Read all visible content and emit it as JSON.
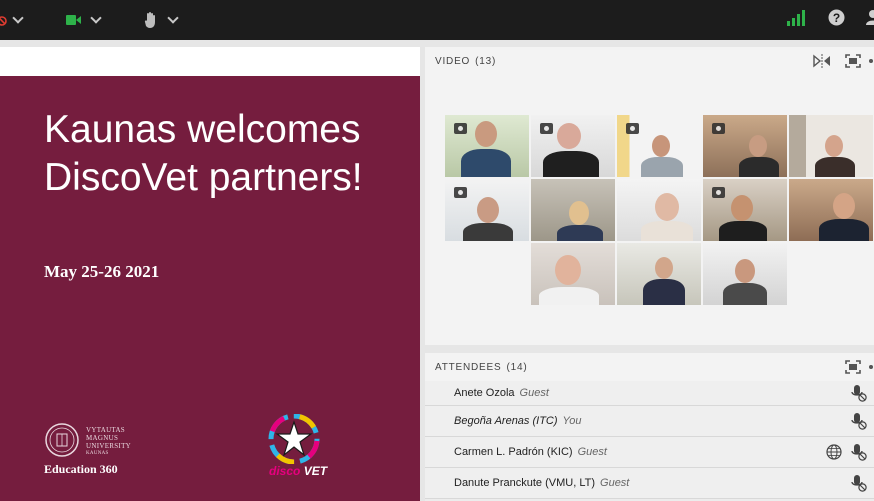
{
  "toolbar": {
    "mic_icon": "mic-muted-icon",
    "camera_icon": "camera-icon",
    "hand_icon": "raise-hand-icon",
    "signal_icon": "signal-icon",
    "help_icon": "help-icon",
    "colors": {
      "camera": "#2eb24a",
      "signal": "#2eb24a",
      "muted": "#e03c31"
    }
  },
  "slide": {
    "title": "Kaunas welcomes DiscoVet partners!",
    "date": "May 25-26 2021",
    "vmu_lines": [
      "VYTAUTAS",
      "MAGNUS",
      "UNIVERSITY",
      "KAUNAS"
    ],
    "education_label": "Education 360",
    "disco_label_1": "disco",
    "disco_label_2": "VET",
    "background_color": "#751d3e"
  },
  "video_pod": {
    "title": "VIDEO",
    "count": "(13)"
  },
  "attendees_pod": {
    "title": "ATTENDEES",
    "count": "(14)",
    "rows": [
      {
        "name": "Anete Ozola",
        "role": "Guest",
        "italic_name": false,
        "globe": false
      },
      {
        "name": "Begoña Arenas (ITC)",
        "role": "You",
        "italic_name": true,
        "globe": false
      },
      {
        "name": "Carmen L. Padrón (KIC)",
        "role": "Guest",
        "italic_name": false,
        "globe": true
      },
      {
        "name": "Danute Pranckute (VMU, LT)",
        "role": "Guest",
        "italic_name": false,
        "globe": false
      }
    ]
  }
}
